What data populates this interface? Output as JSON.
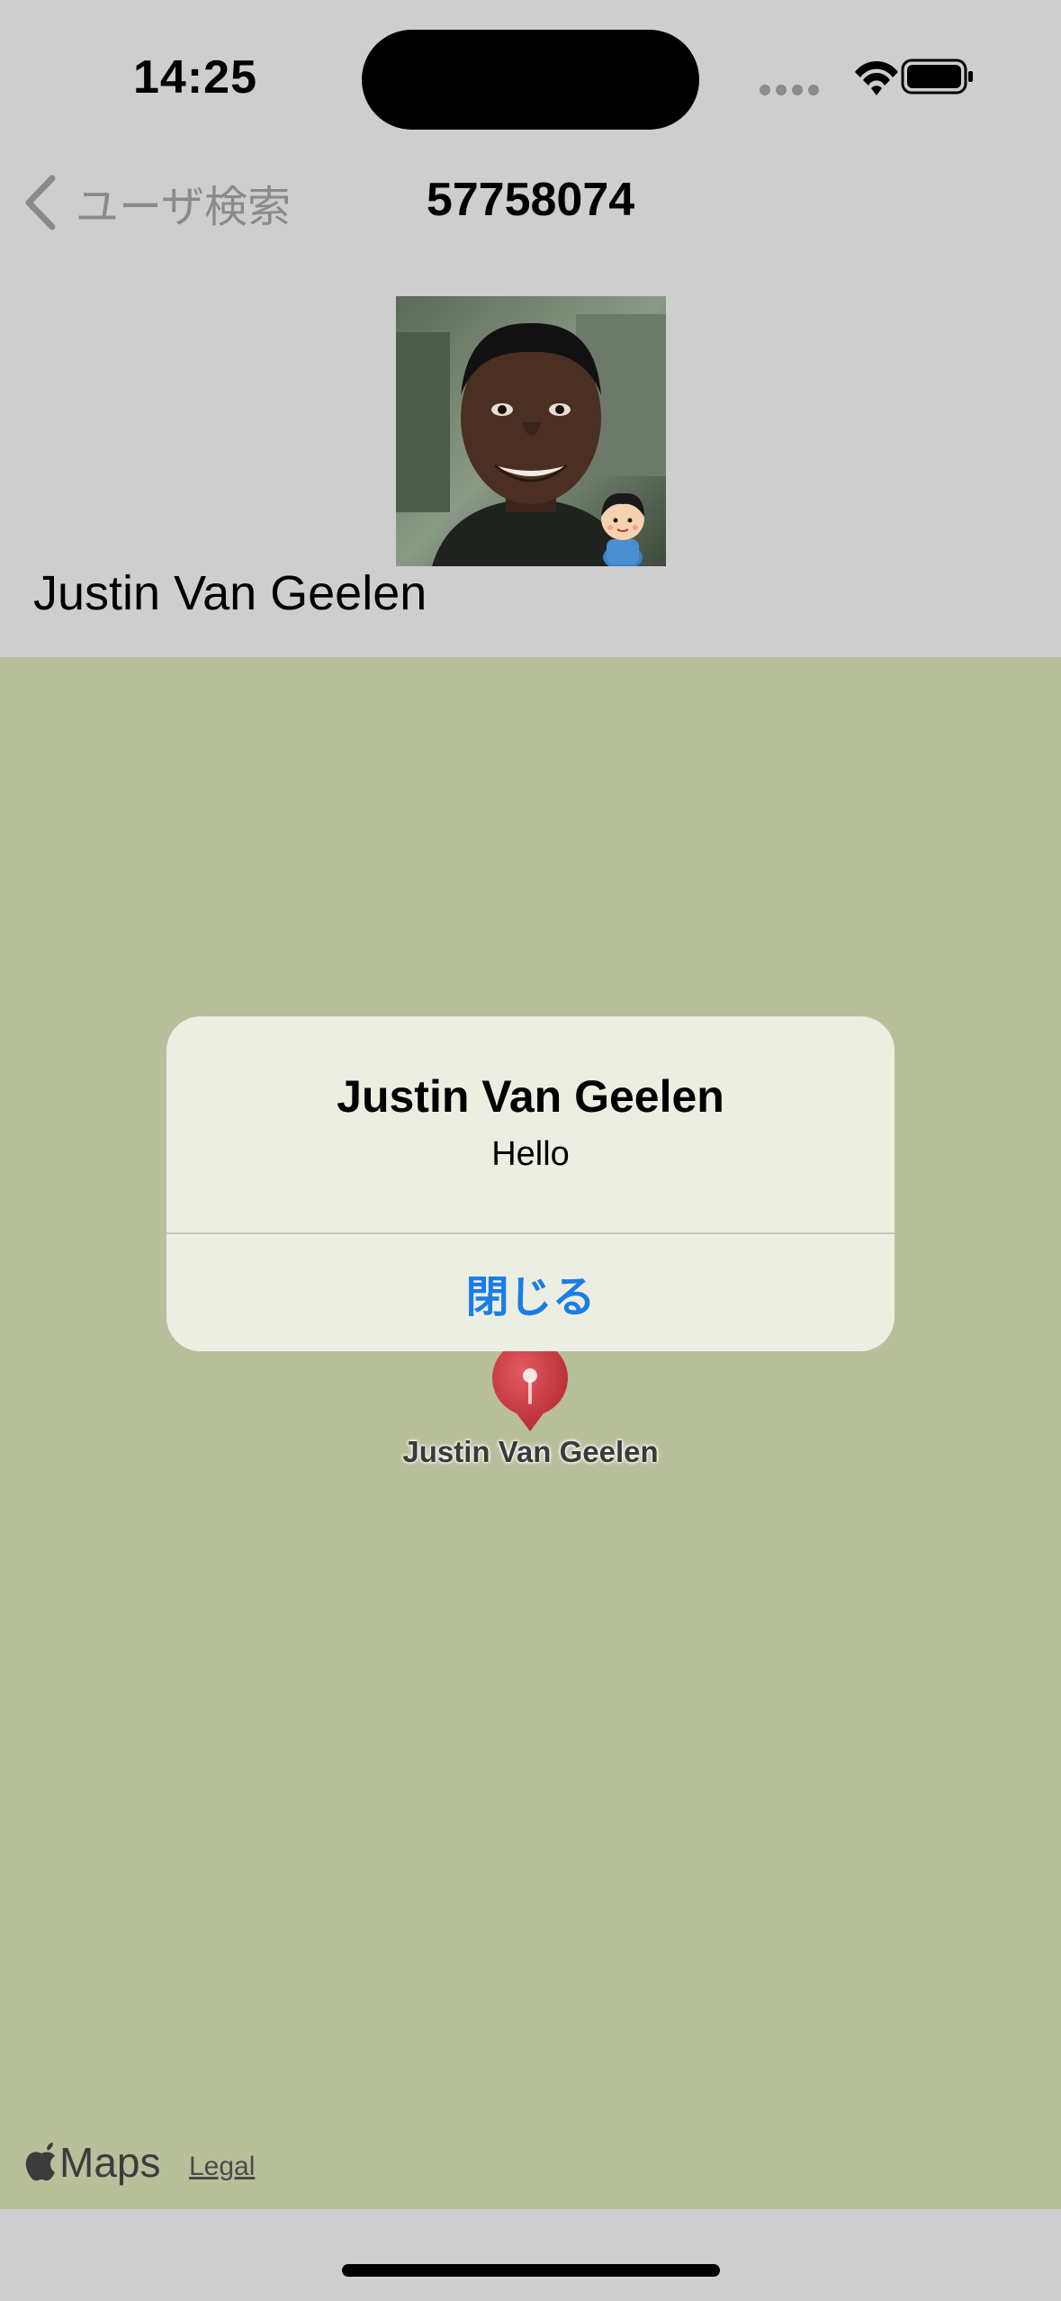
{
  "status_bar": {
    "time": "14:25"
  },
  "nav": {
    "back_label": "ユーザ検索",
    "title": "57758074"
  },
  "profile": {
    "name": "Justin Van Geelen"
  },
  "map": {
    "pin_label": "Justin Van Geelen",
    "attribution": "Maps",
    "legal_label": "Legal"
  },
  "alert": {
    "title": "Justin Van Geelen",
    "message": "Hello",
    "close_label": "閉じる"
  },
  "colors": {
    "background": "#cecece",
    "map": "#b8bf9b",
    "alert_bg": "#edeee2",
    "accent": "#1a7ee6",
    "pin": "#c8323a"
  }
}
